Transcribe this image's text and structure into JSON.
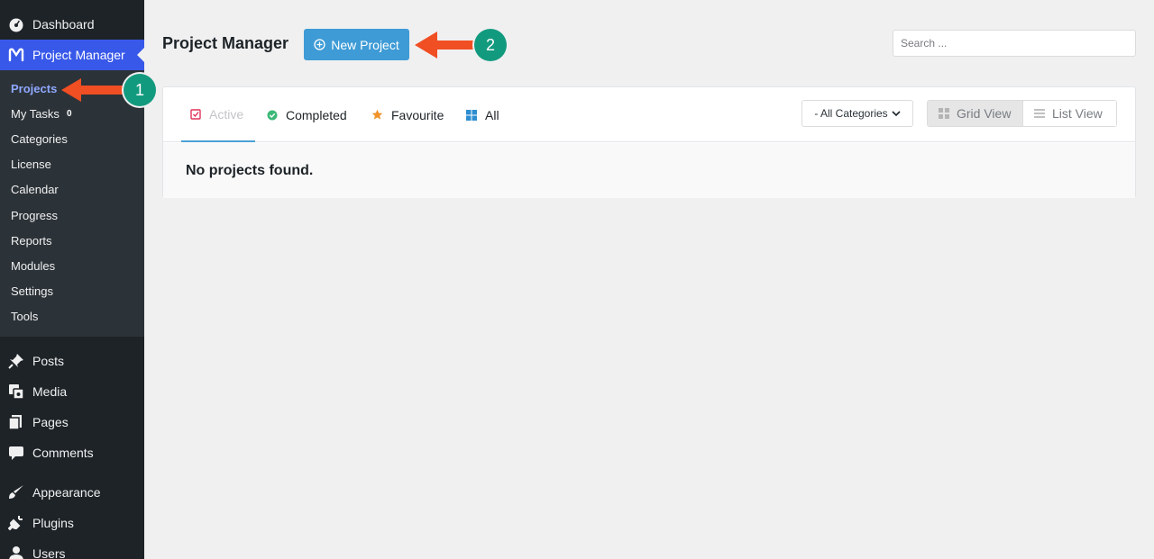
{
  "sidebar": {
    "top": [
      {
        "label": "Dashboard",
        "icon": "dashboard-icon"
      },
      {
        "label": "Project Manager",
        "icon": "project-manager-icon"
      }
    ],
    "submenu": [
      {
        "label": "Projects"
      },
      {
        "label": "My Tasks",
        "badge": "0"
      },
      {
        "label": "Categories"
      },
      {
        "label": "License"
      },
      {
        "label": "Calendar"
      },
      {
        "label": "Progress"
      },
      {
        "label": "Reports"
      },
      {
        "label": "Modules"
      },
      {
        "label": "Settings"
      },
      {
        "label": "Tools"
      }
    ],
    "content": [
      {
        "label": "Posts",
        "icon": "pin-icon"
      },
      {
        "label": "Media",
        "icon": "media-icon"
      },
      {
        "label": "Pages",
        "icon": "pages-icon"
      },
      {
        "label": "Comments",
        "icon": "comment-icon"
      }
    ],
    "appearance": [
      {
        "label": "Appearance",
        "icon": "brush-icon"
      },
      {
        "label": "Plugins",
        "icon": "plug-icon"
      },
      {
        "label": "Users",
        "icon": "user-icon"
      }
    ]
  },
  "header": {
    "title": "Project Manager",
    "new_project_label": "New Project",
    "search_placeholder": "Search ..."
  },
  "tabs": [
    {
      "label": "Active",
      "icon": "checkbox-icon"
    },
    {
      "label": "Completed",
      "icon": "check-circle-icon"
    },
    {
      "label": "Favourite",
      "icon": "star-icon"
    },
    {
      "label": "All",
      "icon": "grid-icon"
    }
  ],
  "filters": {
    "category_selected": "- All Categories",
    "grid_view_label": "Grid View",
    "list_view_label": "List View"
  },
  "empty_message": "No projects found.",
  "annotations": {
    "step1": "1",
    "step2": "2"
  },
  "colors": {
    "accent": "#3858e9",
    "button": "#3e9bd6",
    "annotation_arrow": "#f04e23",
    "annotation_badge": "#129a7e"
  }
}
